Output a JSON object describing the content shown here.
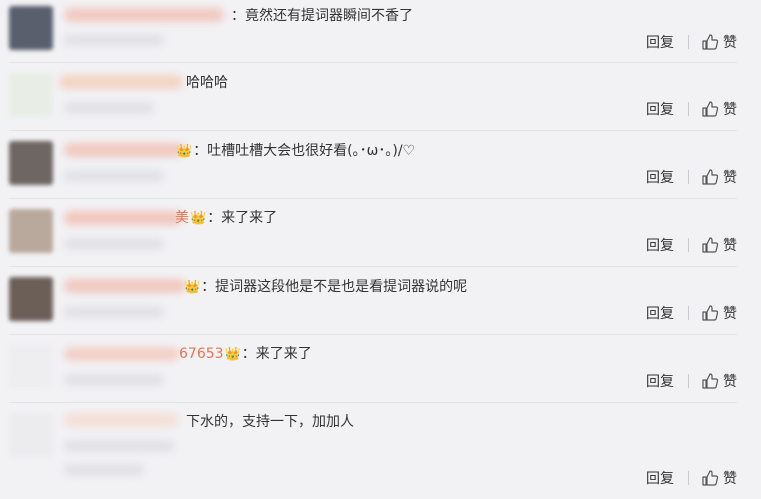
{
  "comments": [
    {
      "text": "：竟然还有提词器瞬间不香了",
      "reply": "回复",
      "like": "赞",
      "avatar_color": "#5a5f6e"
    },
    {
      "text": "哈哈哈",
      "reply": "回复",
      "like": "赞",
      "avatar_color": "#e8eee6"
    },
    {
      "text": "：吐槽吐槽大会也很好看(｡･ω･｡)/♡",
      "reply": "回复",
      "like": "赞",
      "avatar_color": "#6d6662"
    },
    {
      "text": "：来了来了",
      "name_tail": "美",
      "reply": "回复",
      "like": "赞",
      "avatar_color": "#b9a89c"
    },
    {
      "text": "：提词器这段他是不是也是看提词器说的呢",
      "reply": "回复",
      "like": "赞",
      "avatar_color": "#6b5f58"
    },
    {
      "text": "：来了来了",
      "name_tail": "67653",
      "reply": "回复",
      "like": "赞",
      "avatar_color": "#eeeef0"
    },
    {
      "text": "下水的，支持一下，加加人",
      "reply": "回复",
      "like": "赞",
      "avatar_color": "#ececee"
    }
  ],
  "colors": {
    "username": "#eb7350",
    "background": "#f2f2f5"
  }
}
